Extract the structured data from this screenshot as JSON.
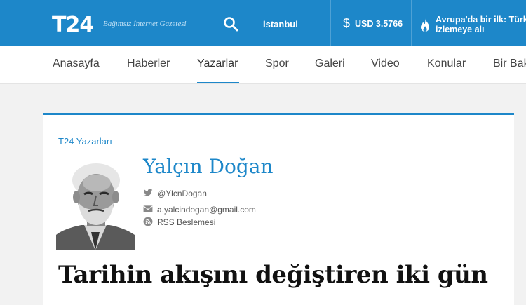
{
  "header": {
    "logo": "T24",
    "tagline": "Bağımsız İnternet Gazetesi",
    "city": "İstanbul",
    "currency_symbol": "$",
    "currency": "USD 3.5766",
    "promo_line1": "Avrupa'da bir ilk: Türkiye",
    "promo_line2": "izlemeye alı"
  },
  "nav": {
    "items": [
      {
        "label": "Anasayfa"
      },
      {
        "label": "Haberler"
      },
      {
        "label": "Yazarlar"
      },
      {
        "label": "Spor"
      },
      {
        "label": "Galeri"
      },
      {
        "label": "Video"
      },
      {
        "label": "Konular"
      },
      {
        "label": "Bir Bak"
      }
    ],
    "active": "Yazarlar"
  },
  "author": {
    "section": "T24 Yazarları",
    "name": "Yalçın Doğan",
    "twitter": "@YlcnDogan",
    "email": "a.yalcindogan@gmail.com",
    "rss": "RSS Beslemesi"
  },
  "article": {
    "title": "Tarihin akışını değiştiren iki gün"
  },
  "colors": {
    "brand": "#1d87c9",
    "title": "#111111"
  }
}
